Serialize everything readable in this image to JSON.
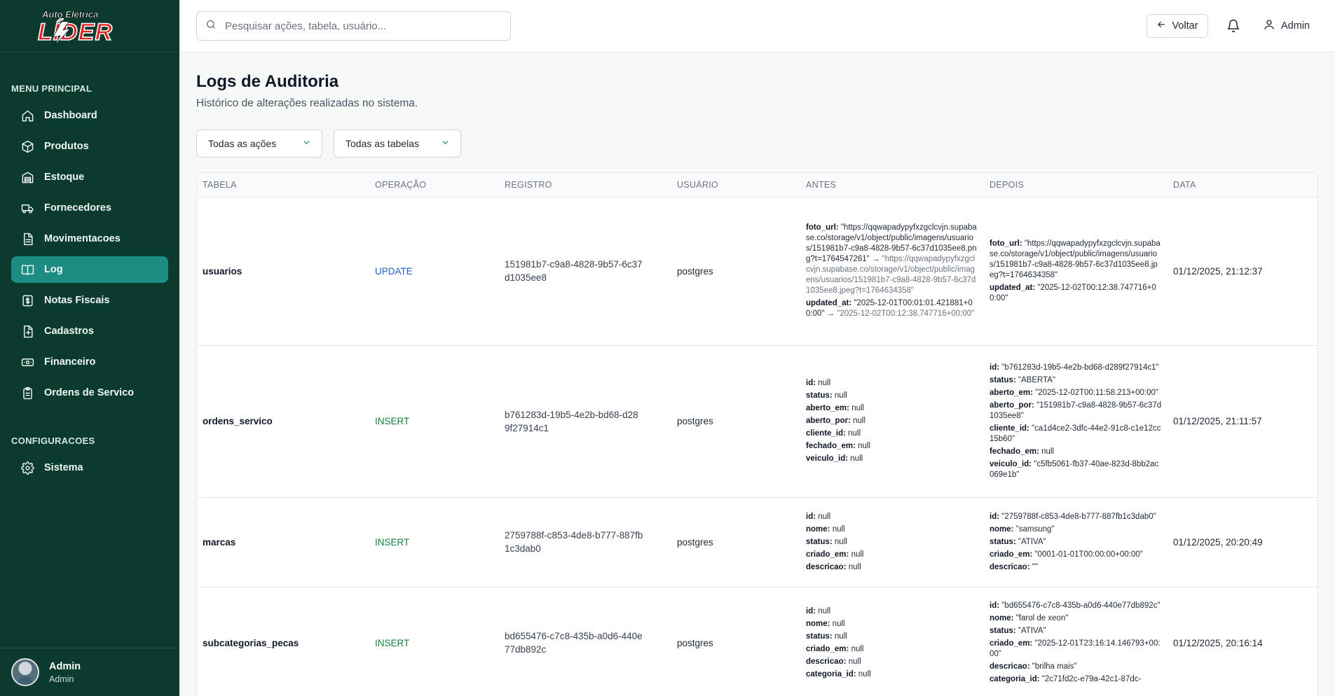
{
  "brand": {
    "logo_top": "Auto Elétrica",
    "logo_main": "LÍDER"
  },
  "sidebar": {
    "section_main": "MENU PRINCIPAL",
    "items": [
      {
        "label": "Dashboard",
        "icon": "home-icon"
      },
      {
        "label": "Produtos",
        "icon": "box-icon"
      },
      {
        "label": "Estoque",
        "icon": "warehouse-icon"
      },
      {
        "label": "Fornecedores",
        "icon": "truck-icon"
      },
      {
        "label": "Movimentacoes",
        "icon": "file-icon"
      },
      {
        "label": "Log",
        "icon": "book-icon"
      },
      {
        "label": "Notas Fiscais",
        "icon": "dollar-icon"
      },
      {
        "label": "Cadastros",
        "icon": "file-plus-icon"
      },
      {
        "label": "Financeiro",
        "icon": "banknote-icon"
      },
      {
        "label": "Ordens de Servico",
        "icon": "clipboard-icon"
      }
    ],
    "section_config": "CONFIGURACOES",
    "config_items": [
      {
        "label": "Sistema",
        "icon": "gear-icon"
      }
    ],
    "user": {
      "name": "Admin",
      "role": "Admin"
    }
  },
  "topbar": {
    "search_placeholder": "Pesquisar ações, tabela, usuário...",
    "back_label": "Voltar",
    "user_label": "Admin"
  },
  "page": {
    "title": "Logs de Auditoria",
    "subtitle": "Histórico de alterações realizadas no sistema."
  },
  "filters": {
    "actions": "Todas as ações",
    "tables": "Todas as tabelas"
  },
  "table": {
    "headers": [
      "TABELA",
      "OPERAÇÃO",
      "REGISTRO",
      "USUÁRIO",
      "ANTES",
      "DEPOIS",
      "DATA"
    ],
    "rows": [
      {
        "tabela": "usuarios",
        "operacao": "UPDATE",
        "registro": "151981b7-c9a8-4828-9b57-6c37d1035ee8",
        "usuario": "postgres",
        "antes": [
          {
            "k": "foto_url:",
            "v": "\"https://qqwapadypyfxzgclcvjn.supabase.co/storage/v1/object/public/imagens/usuarios/151981b7-c9a8-4828-9b57-6c37d1035ee8.png?t=1764547261\" →",
            "old": "\"https://qqwapadypyfxzgclcvjn.supabase.co/storage/v1/object/public/imagens/usuarios/151981b7-c9a8-4828-9b57-6c37d1035ee8.jpeg?t=1764634358\""
          },
          {
            "k": "updated_at:",
            "v": "\"2025-12-01T00:01:01.421881+00:00\" →",
            "old": "\"2025-12-02T00:12:38.747716+00:00\""
          }
        ],
        "depois": [
          {
            "k": "foto_url:",
            "v": "\"https://qqwapadypyfxzgclcvjn.supabase.co/storage/v1/object/public/imagens/usuarios/151981b7-c9a8-4828-9b57-6c37d1035ee8.jpeg?t=1764634358\""
          },
          {
            "k": "updated_at:",
            "v": "\"2025-12-02T00:12:38.747716+00:00\""
          }
        ],
        "data": "01/12/2025, 21:12:37"
      },
      {
        "tabela": "ordens_servico",
        "operacao": "INSERT",
        "registro": "b761283d-19b5-4e2b-bd68-d289f27914c1",
        "usuario": "postgres",
        "antes": [
          {
            "k": "id:",
            "v": "null"
          },
          {
            "k": "status:",
            "v": "null"
          },
          {
            "k": "aberto_em:",
            "v": "null"
          },
          {
            "k": "aberto_por:",
            "v": "null"
          },
          {
            "k": "cliente_id:",
            "v": "null"
          },
          {
            "k": "fechado_em:",
            "v": "null"
          },
          {
            "k": "veiculo_id:",
            "v": "null"
          }
        ],
        "depois": [
          {
            "k": "id:",
            "v": "\"b761283d-19b5-4e2b-bd68-d289f27914c1\""
          },
          {
            "k": "status:",
            "v": "\"ABERTA\""
          },
          {
            "k": "aberto_em:",
            "v": "\"2025-12-02T00:11:58.213+00:00\""
          },
          {
            "k": "aberto_por:",
            "v": "\"151981b7-c9a8-4828-9b57-6c37d1035ee8\""
          },
          {
            "k": "cliente_id:",
            "v": "\"ca1d4ce2-3dfc-44e2-91c8-c1e12cc15b60\""
          },
          {
            "k": "fechado_em:",
            "v": "null"
          },
          {
            "k": "veiculo_id:",
            "v": "\"c5fb5061-fb37-40ae-823d-8bb2ac069e1b\""
          }
        ],
        "data": "01/12/2025, 21:11:57"
      },
      {
        "tabela": "marcas",
        "operacao": "INSERT",
        "registro": "2759788f-c853-4de8-b777-887fb1c3dab0",
        "usuario": "postgres",
        "antes": [
          {
            "k": "id:",
            "v": "null"
          },
          {
            "k": "nome:",
            "v": "null"
          },
          {
            "k": "status:",
            "v": "null"
          },
          {
            "k": "criado_em:",
            "v": "null"
          },
          {
            "k": "descricao:",
            "v": "null"
          }
        ],
        "depois": [
          {
            "k": "id:",
            "v": "\"2759788f-c853-4de8-b777-887fb1c3dab0\""
          },
          {
            "k": "nome:",
            "v": "\"samsung\""
          },
          {
            "k": "status:",
            "v": "\"ATIVA\""
          },
          {
            "k": "criado_em:",
            "v": "\"0001-01-01T00:00:00+00:00\""
          },
          {
            "k": "descricao:",
            "v": "\"\""
          }
        ],
        "data": "01/12/2025, 20:20:49"
      },
      {
        "tabela": "subcategorias_pecas",
        "operacao": "INSERT",
        "registro": "bd655476-c7c8-435b-a0d6-440e77db892c",
        "usuario": "postgres",
        "antes": [
          {
            "k": "id:",
            "v": "null"
          },
          {
            "k": "nome:",
            "v": "null"
          },
          {
            "k": "status:",
            "v": "null"
          },
          {
            "k": "criado_em:",
            "v": "null"
          },
          {
            "k": "descricao:",
            "v": "null"
          },
          {
            "k": "categoria_id:",
            "v": "null"
          }
        ],
        "depois": [
          {
            "k": "id:",
            "v": "\"bd655476-c7c8-435b-a0d6-440e77db892c\""
          },
          {
            "k": "nome:",
            "v": "\"farol de xeon\""
          },
          {
            "k": "status:",
            "v": "\"ATIVA\""
          },
          {
            "k": "criado_em:",
            "v": "\"2025-12-01T23:16:14.146793+00:00\""
          },
          {
            "k": "descricao:",
            "v": "\"brilha mais\""
          },
          {
            "k": "categoria_id:",
            "v": "\"2c71fd2c-e79a-42c1-87dc-"
          }
        ],
        "data": "01/12/2025, 20:16:14"
      }
    ]
  },
  "colors": {
    "sidebar": "#0b3b2e",
    "active": "#1d8c82",
    "insert": "#15803d",
    "update": "#1d5fbf"
  }
}
